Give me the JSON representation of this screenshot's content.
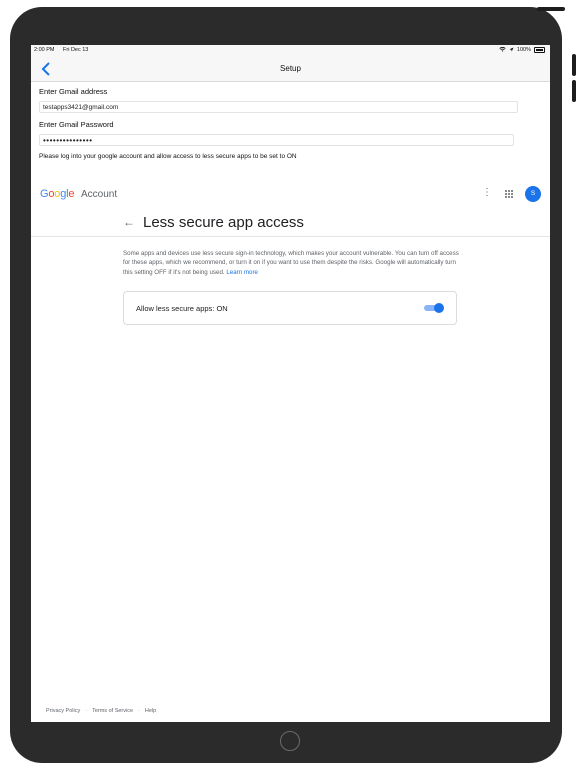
{
  "status_bar": {
    "time": "2:00 PM",
    "date": "Fri Dec 13",
    "battery": "100%"
  },
  "nav": {
    "title": "Setup",
    "back_icon": "chevron-left-icon"
  },
  "form": {
    "email_label": "Enter Gmail address",
    "email_value": "testapps3421@gmail.com",
    "password_label": "Enter Gmail Password",
    "password_value": "•••••••••••••••",
    "note": "Please log into your google account and allow access to less secure apps to be set to ON"
  },
  "google_header": {
    "logo_letters": [
      {
        "ch": "G",
        "color": "#4285F4"
      },
      {
        "ch": "o",
        "color": "#EA4335"
      },
      {
        "ch": "o",
        "color": "#FBBC05"
      },
      {
        "ch": "g",
        "color": "#4285F4"
      },
      {
        "ch": "l",
        "color": "#34A853"
      },
      {
        "ch": "e",
        "color": "#EA4335"
      }
    ],
    "account_label": "Account",
    "avatar_initial": "S"
  },
  "page": {
    "title": "Less secure app access",
    "description": "Some apps and devices use less secure sign-in technology, which makes your account vulnerable. You can turn off access for these apps, which we recommend, or turn it on if you want to use them despite the risks. Google will automatically turn this setting OFF if it's not being used.",
    "learn_more": "Learn more",
    "setting_label": "Allow less secure apps: ON",
    "setting_on": true
  },
  "footer": {
    "privacy": "Privacy Policy",
    "terms": "Terms of Service",
    "help": "Help",
    "separator": "·"
  }
}
